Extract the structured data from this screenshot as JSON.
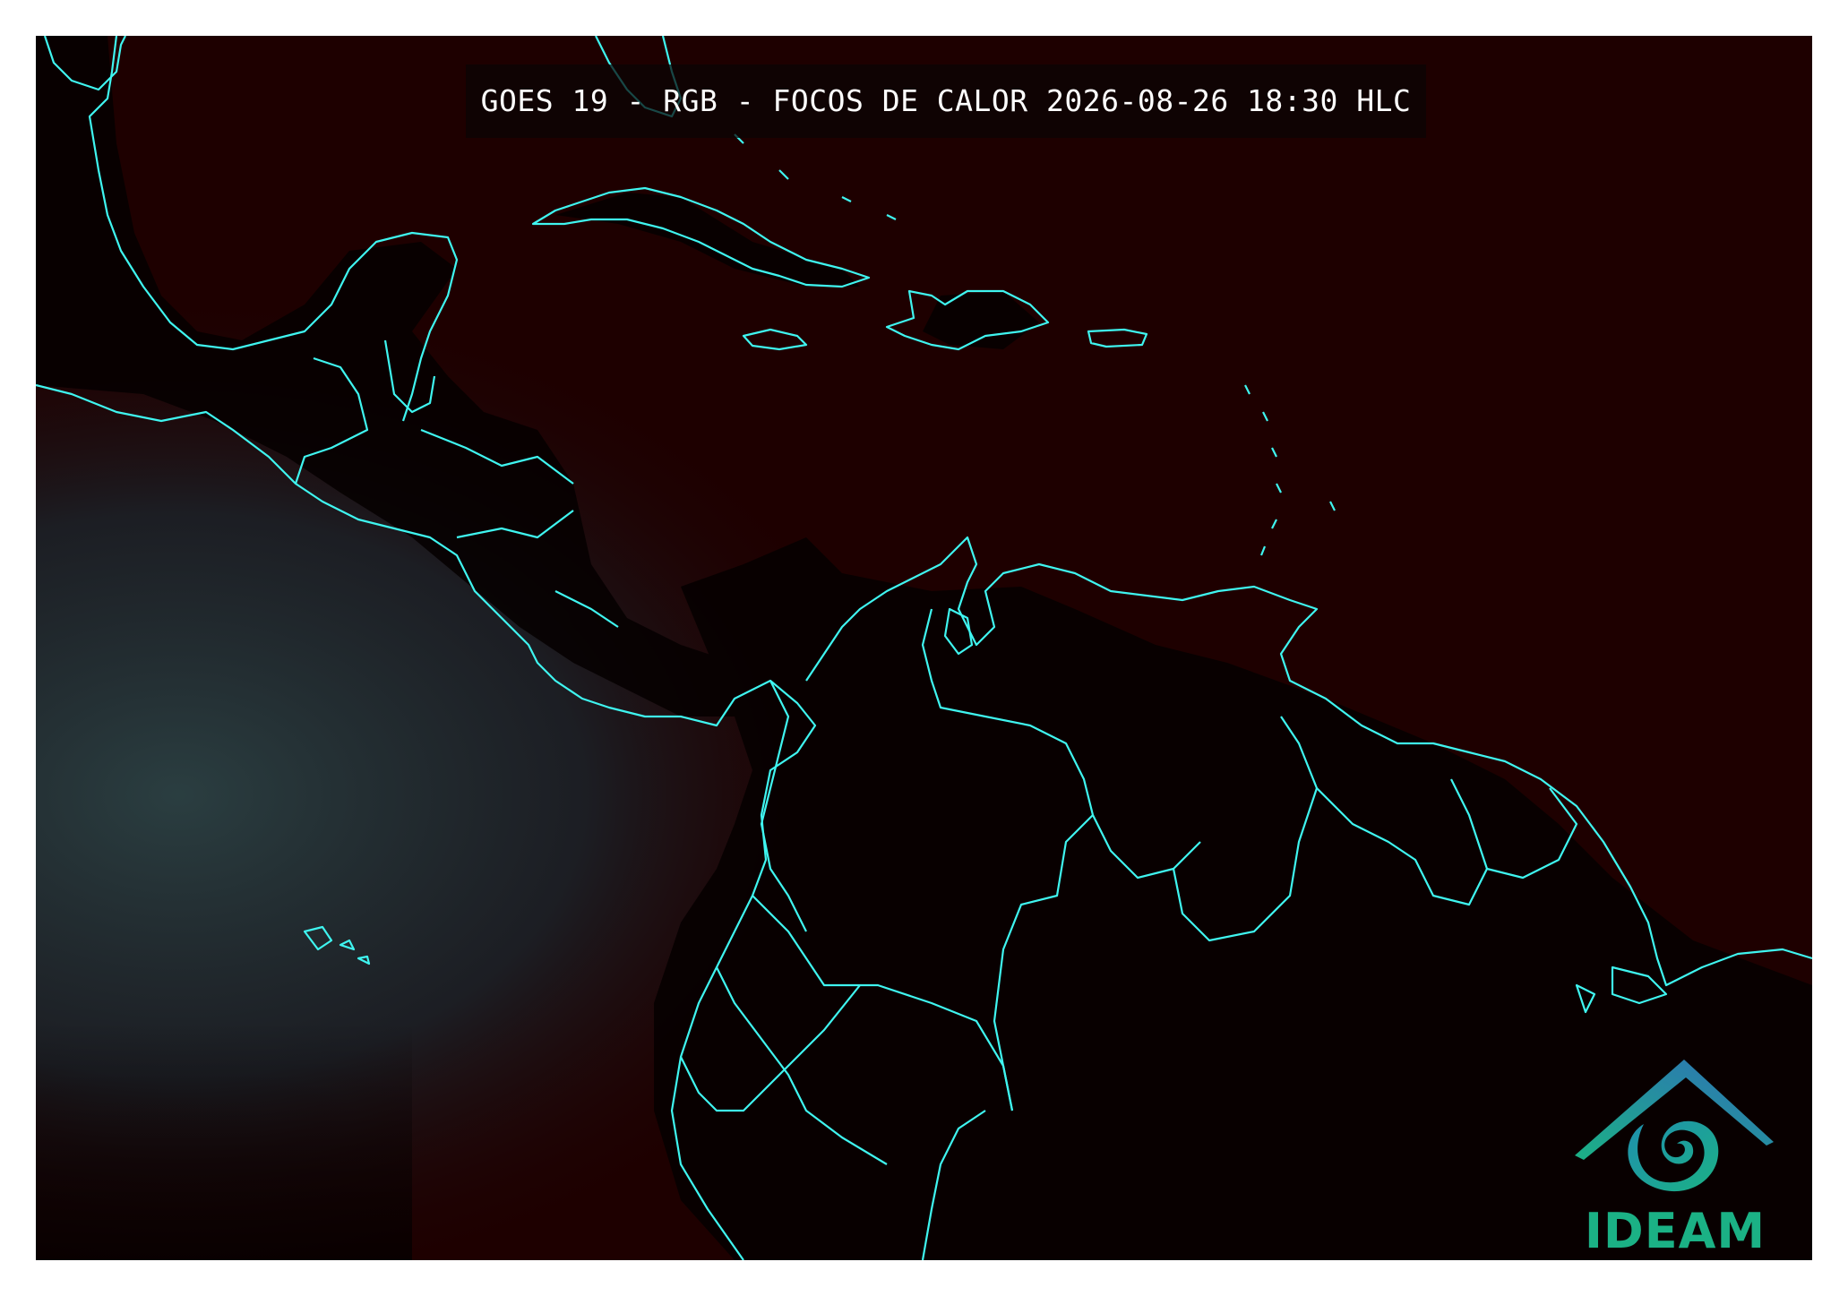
{
  "map": {
    "title": "GOES 19 - RGB - FOCOS DE CALOR 2026-08-26 18:30 HLC",
    "background_color": "#1e0000",
    "coastline_color": "#3ff5f0"
  },
  "logo": {
    "name": "IDEAM",
    "icon": "ideam-logo-icon",
    "text_color": "#1bb185",
    "roof_color": "#2f6fb8"
  }
}
